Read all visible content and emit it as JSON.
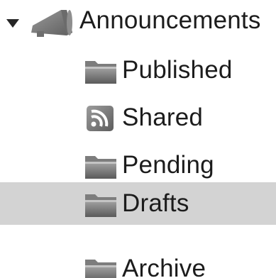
{
  "tree": {
    "root": {
      "label": "Announcements",
      "icon": "megaphone-icon",
      "expanded": true
    },
    "children": [
      {
        "label": "Published",
        "icon": "folder-icon",
        "selected": false
      },
      {
        "label": "Shared",
        "icon": "rss-feed-icon",
        "selected": false
      },
      {
        "label": "Pending",
        "icon": "folder-icon",
        "selected": false
      },
      {
        "label": "Drafts",
        "icon": "folder-icon",
        "selected": true
      },
      {
        "label": "Archive",
        "icon": "folder-icon",
        "selected": false
      }
    ]
  },
  "colors": {
    "selected_row": "#d3d3d3",
    "text": "#1c1c1c",
    "icon_gray": "#7a7a7a"
  }
}
